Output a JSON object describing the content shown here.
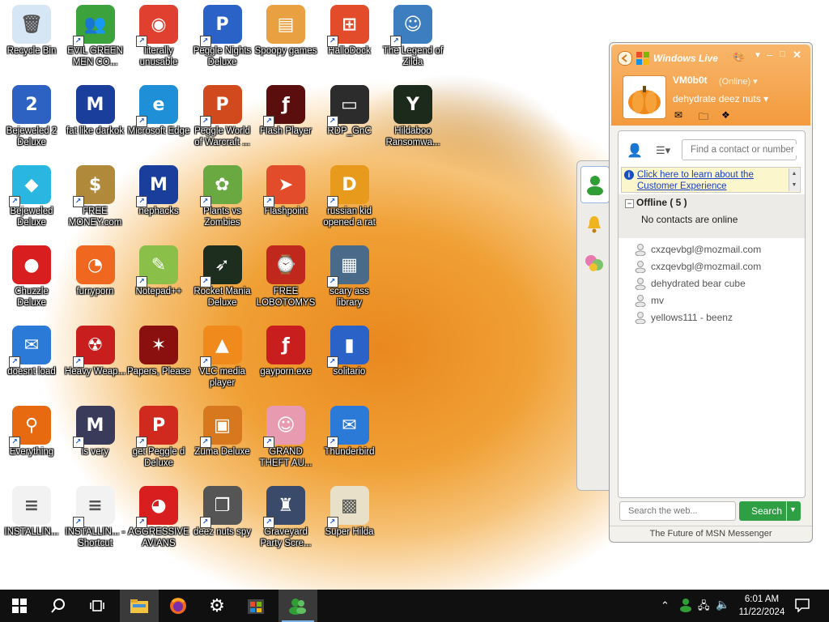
{
  "desktop_icons": [
    {
      "label": "Recycle Bin",
      "glyph": "🗑",
      "color": "#d7e6f5",
      "shortcut": false
    },
    {
      "label": "EVIL GREEN MEN CO...",
      "glyph": "👥",
      "color": "#3ca23c",
      "shortcut": true
    },
    {
      "label": "literally unusable",
      "glyph": "◉",
      "color": "#e0402f",
      "shortcut": true
    },
    {
      "label": "Peggle Nights Deluxe",
      "glyph": "P",
      "color": "#2a62c8",
      "shortcut": true
    },
    {
      "label": "Spoopy games",
      "glyph": "▤",
      "color": "#e8a040",
      "shortcut": false
    },
    {
      "label": "HalloDock",
      "glyph": "⊞",
      "color": "#e24c2a",
      "shortcut": true
    },
    {
      "label": "The Legend of Zilda",
      "glyph": "☺",
      "color": "#3c7ec0",
      "shortcut": true
    },
    {
      "label": "Bejeweled 2 Deluxe",
      "glyph": "2",
      "color": "#2e62c2",
      "shortcut": false
    },
    {
      "label": "fat like darkok",
      "glyph": "M",
      "color": "#1a3e9c",
      "shortcut": false
    },
    {
      "label": "Microsoft Edge",
      "glyph": "e",
      "color": "#1f8fd8",
      "shortcut": true
    },
    {
      "label": "Peggle World of Warcraft ...",
      "glyph": "P",
      "color": "#d04a1e",
      "shortcut": true
    },
    {
      "label": "Flash Player",
      "glyph": "ƒ",
      "color": "#5a0e0e",
      "shortcut": true
    },
    {
      "label": "RDP_GnC",
      "glyph": "▭",
      "color": "#2c2c2c",
      "shortcut": true
    },
    {
      "label": "Hildaboo Ransomwa...",
      "glyph": "Y",
      "color": "#1c2a1c",
      "shortcut": false
    },
    {
      "label": "Bejeweled Deluxe",
      "glyph": "◆",
      "color": "#29b6e0",
      "shortcut": true
    },
    {
      "label": "FREE MONEY.com",
      "glyph": "$",
      "color": "#b08a3a",
      "shortcut": true
    },
    {
      "label": "nephacks",
      "glyph": "M",
      "color": "#1a3e9c",
      "shortcut": true
    },
    {
      "label": "Plants vs Zombies",
      "glyph": "✿",
      "color": "#6aa842",
      "shortcut": true
    },
    {
      "label": "Flashpoint",
      "glyph": "➤",
      "color": "#e24c2a",
      "shortcut": true
    },
    {
      "label": "russian kid opened a rat",
      "glyph": "D",
      "color": "#e89a1c",
      "shortcut": true
    },
    {
      "label": "Chuzzle Deluxe",
      "glyph": "●",
      "color": "#d81e1e",
      "shortcut": false
    },
    {
      "label": "furryporn",
      "glyph": "◔",
      "color": "#f06820",
      "shortcut": false
    },
    {
      "label": "Notepad++",
      "glyph": "✎",
      "color": "#8ac04a",
      "shortcut": true
    },
    {
      "label": "Rocket Mania Deluxe",
      "glyph": "➶",
      "color": "#1e2e1e",
      "shortcut": true
    },
    {
      "label": "FREE LOBOTOMYS",
      "glyph": "⌚",
      "color": "#c0281e",
      "shortcut": false
    },
    {
      "label": "scary ass library",
      "glyph": "▦",
      "color": "#4a6a8a",
      "shortcut": true
    },
    {
      "label": "doesnt load",
      "glyph": "✉",
      "color": "#2c7ad8",
      "shortcut": true
    },
    {
      "label": "Heavy Weap...",
      "glyph": "☢",
      "color": "#c81e1e",
      "shortcut": true
    },
    {
      "label": "Papers, Please",
      "glyph": "✶",
      "color": "#8a1010",
      "shortcut": false
    },
    {
      "label": "VLC media player",
      "glyph": "▲",
      "color": "#f08a1c",
      "shortcut": true
    },
    {
      "label": "gayporn.exe",
      "glyph": "ƒ",
      "color": "#c81e1e",
      "shortcut": false
    },
    {
      "label": "solitario",
      "glyph": "▮",
      "color": "#2a62c8",
      "shortcut": true
    },
    {
      "label": "Everything",
      "glyph": "⚲",
      "color": "#e86a10",
      "shortcut": true
    },
    {
      "label": "is very",
      "glyph": "M",
      "color": "#3a3a5a",
      "shortcut": true
    },
    {
      "label": "get Peggle d Deluxe",
      "glyph": "P",
      "color": "#d02a1e",
      "shortcut": true
    },
    {
      "label": "Zuma Deluxe",
      "glyph": "▣",
      "color": "#d8781e",
      "shortcut": true
    },
    {
      "label": "GRAND THEFT AU...",
      "glyph": "☺",
      "color": "#e89ab0",
      "shortcut": true
    },
    {
      "label": "Thunderbird",
      "glyph": "✉",
      "color": "#2c7ad8",
      "shortcut": true
    },
    {
      "label": "INSTALLIN...",
      "glyph": "≡",
      "color": "#f2f2f2",
      "shortcut": false
    },
    {
      "label": "INSTALLIN... - Shortcut",
      "glyph": "≡",
      "color": "#f2f2f2",
      "shortcut": true
    },
    {
      "label": "AGGRESSIVE AVIANS",
      "glyph": "◕",
      "color": "#d81e1e",
      "shortcut": true
    },
    {
      "label": "deez nuts spy",
      "glyph": "❐",
      "color": "#555555",
      "shortcut": true
    },
    {
      "label": "Graveyard Party Scre...",
      "glyph": "♜",
      "color": "#3a4a6a",
      "shortcut": true
    },
    {
      "label": "Super Hilda",
      "glyph": "▩",
      "color": "#e8e0c8",
      "shortcut": true
    }
  ],
  "msn": {
    "brand": "Windows Live",
    "username": "VM0b0t",
    "status": "(Online)",
    "personal_message": "dehydrate deez nuts",
    "search_contact_placeholder": "Find a contact or number",
    "notice_text": "Click here to learn about the Customer Experience",
    "group_label": "Offline ( 5 )",
    "no_contacts_text": "No contacts are online",
    "contacts": [
      "cxzqevbgl@mozmail.com",
      "cxzqevbgl@mozmail.com",
      "dehydrated bear cube",
      "mv",
      "yellows111 - beenz"
    ],
    "web_search_placeholder": "Search the web...",
    "search_button": "Search",
    "footer": "The Future of MSN Messenger"
  },
  "taskbar": {
    "time": "6:01 AM",
    "date": "11/22/2024"
  },
  "colors": {
    "msn_orange": "#f39a3d",
    "search_green": "#2ea043",
    "link_blue": "#1a3ec8",
    "taskbar": "#101010"
  }
}
